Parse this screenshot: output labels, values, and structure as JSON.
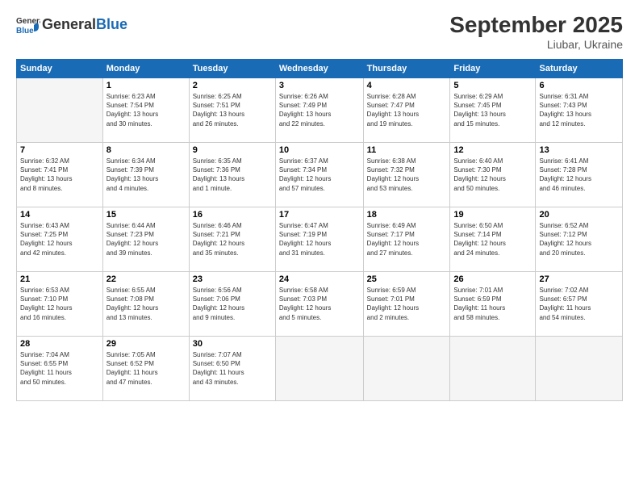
{
  "header": {
    "logo_general": "General",
    "logo_blue": "Blue",
    "month_title": "September 2025",
    "subtitle": "Liubar, Ukraine"
  },
  "days_of_week": [
    "Sunday",
    "Monday",
    "Tuesday",
    "Wednesday",
    "Thursday",
    "Friday",
    "Saturday"
  ],
  "weeks": [
    [
      {
        "day": "",
        "info": ""
      },
      {
        "day": "1",
        "info": "Sunrise: 6:23 AM\nSunset: 7:54 PM\nDaylight: 13 hours\nand 30 minutes."
      },
      {
        "day": "2",
        "info": "Sunrise: 6:25 AM\nSunset: 7:51 PM\nDaylight: 13 hours\nand 26 minutes."
      },
      {
        "day": "3",
        "info": "Sunrise: 6:26 AM\nSunset: 7:49 PM\nDaylight: 13 hours\nand 22 minutes."
      },
      {
        "day": "4",
        "info": "Sunrise: 6:28 AM\nSunset: 7:47 PM\nDaylight: 13 hours\nand 19 minutes."
      },
      {
        "day": "5",
        "info": "Sunrise: 6:29 AM\nSunset: 7:45 PM\nDaylight: 13 hours\nand 15 minutes."
      },
      {
        "day": "6",
        "info": "Sunrise: 6:31 AM\nSunset: 7:43 PM\nDaylight: 13 hours\nand 12 minutes."
      }
    ],
    [
      {
        "day": "7",
        "info": "Sunrise: 6:32 AM\nSunset: 7:41 PM\nDaylight: 13 hours\nand 8 minutes."
      },
      {
        "day": "8",
        "info": "Sunrise: 6:34 AM\nSunset: 7:39 PM\nDaylight: 13 hours\nand 4 minutes."
      },
      {
        "day": "9",
        "info": "Sunrise: 6:35 AM\nSunset: 7:36 PM\nDaylight: 13 hours\nand 1 minute."
      },
      {
        "day": "10",
        "info": "Sunrise: 6:37 AM\nSunset: 7:34 PM\nDaylight: 12 hours\nand 57 minutes."
      },
      {
        "day": "11",
        "info": "Sunrise: 6:38 AM\nSunset: 7:32 PM\nDaylight: 12 hours\nand 53 minutes."
      },
      {
        "day": "12",
        "info": "Sunrise: 6:40 AM\nSunset: 7:30 PM\nDaylight: 12 hours\nand 50 minutes."
      },
      {
        "day": "13",
        "info": "Sunrise: 6:41 AM\nSunset: 7:28 PM\nDaylight: 12 hours\nand 46 minutes."
      }
    ],
    [
      {
        "day": "14",
        "info": "Sunrise: 6:43 AM\nSunset: 7:25 PM\nDaylight: 12 hours\nand 42 minutes."
      },
      {
        "day": "15",
        "info": "Sunrise: 6:44 AM\nSunset: 7:23 PM\nDaylight: 12 hours\nand 39 minutes."
      },
      {
        "day": "16",
        "info": "Sunrise: 6:46 AM\nSunset: 7:21 PM\nDaylight: 12 hours\nand 35 minutes."
      },
      {
        "day": "17",
        "info": "Sunrise: 6:47 AM\nSunset: 7:19 PM\nDaylight: 12 hours\nand 31 minutes."
      },
      {
        "day": "18",
        "info": "Sunrise: 6:49 AM\nSunset: 7:17 PM\nDaylight: 12 hours\nand 27 minutes."
      },
      {
        "day": "19",
        "info": "Sunrise: 6:50 AM\nSunset: 7:14 PM\nDaylight: 12 hours\nand 24 minutes."
      },
      {
        "day": "20",
        "info": "Sunrise: 6:52 AM\nSunset: 7:12 PM\nDaylight: 12 hours\nand 20 minutes."
      }
    ],
    [
      {
        "day": "21",
        "info": "Sunrise: 6:53 AM\nSunset: 7:10 PM\nDaylight: 12 hours\nand 16 minutes."
      },
      {
        "day": "22",
        "info": "Sunrise: 6:55 AM\nSunset: 7:08 PM\nDaylight: 12 hours\nand 13 minutes."
      },
      {
        "day": "23",
        "info": "Sunrise: 6:56 AM\nSunset: 7:06 PM\nDaylight: 12 hours\nand 9 minutes."
      },
      {
        "day": "24",
        "info": "Sunrise: 6:58 AM\nSunset: 7:03 PM\nDaylight: 12 hours\nand 5 minutes."
      },
      {
        "day": "25",
        "info": "Sunrise: 6:59 AM\nSunset: 7:01 PM\nDaylight: 12 hours\nand 2 minutes."
      },
      {
        "day": "26",
        "info": "Sunrise: 7:01 AM\nSunset: 6:59 PM\nDaylight: 11 hours\nand 58 minutes."
      },
      {
        "day": "27",
        "info": "Sunrise: 7:02 AM\nSunset: 6:57 PM\nDaylight: 11 hours\nand 54 minutes."
      }
    ],
    [
      {
        "day": "28",
        "info": "Sunrise: 7:04 AM\nSunset: 6:55 PM\nDaylight: 11 hours\nand 50 minutes."
      },
      {
        "day": "29",
        "info": "Sunrise: 7:05 AM\nSunset: 6:52 PM\nDaylight: 11 hours\nand 47 minutes."
      },
      {
        "day": "30",
        "info": "Sunrise: 7:07 AM\nSunset: 6:50 PM\nDaylight: 11 hours\nand 43 minutes."
      },
      {
        "day": "",
        "info": ""
      },
      {
        "day": "",
        "info": ""
      },
      {
        "day": "",
        "info": ""
      },
      {
        "day": "",
        "info": ""
      }
    ]
  ]
}
